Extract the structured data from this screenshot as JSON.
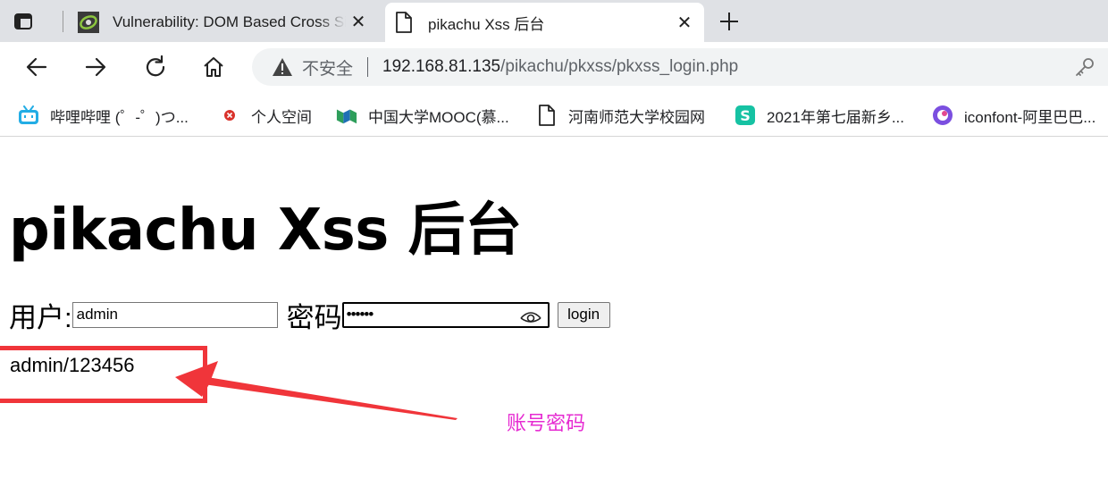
{
  "browser": {
    "tabs": [
      {
        "title": "Vulnerability: DOM Based Cross Site Scripting (XSS)",
        "icon": "dvwa-icon",
        "active": false
      },
      {
        "title": "pikachu Xss 后台",
        "icon": "page-icon",
        "active": true
      }
    ],
    "close_glyph": "✕",
    "address": {
      "security_label": "不安全",
      "url_host": "192.168.81.135",
      "url_path": "/pikachu/pkxss/pkxss_login.php"
    },
    "bookmarks": [
      {
        "label": "哔哩哔哩 (゜-゜)つ...",
        "icon": "bilibili-icon",
        "color": "#23ade5"
      },
      {
        "label": "个人空间",
        "icon": "red-dot-icon",
        "color": "#d9322b"
      },
      {
        "label": "中国大学MOOC(慕...",
        "icon": "mooc-icon",
        "color": "#2e9e5b"
      },
      {
        "label": "河南师范大学校园网",
        "icon": "page-icon",
        "color": "#333333"
      },
      {
        "label": "2021年第七届新乡...",
        "icon": "s-app-icon",
        "color": "#16c2a3"
      },
      {
        "label": "iconfont-阿里巴巴...",
        "icon": "iconfont-icon",
        "color": "#7b4fe0"
      }
    ]
  },
  "page": {
    "heading": "pikachu Xss 后台",
    "user_label": "用户:",
    "user_value": "admin",
    "password_label": "密码",
    "password_mask": "••••••",
    "login_button": "login",
    "credentials_hint": "admin/123456"
  },
  "annotation": {
    "label": "账号密码",
    "box_color": "#f0353a",
    "label_color": "#e62bd2"
  }
}
